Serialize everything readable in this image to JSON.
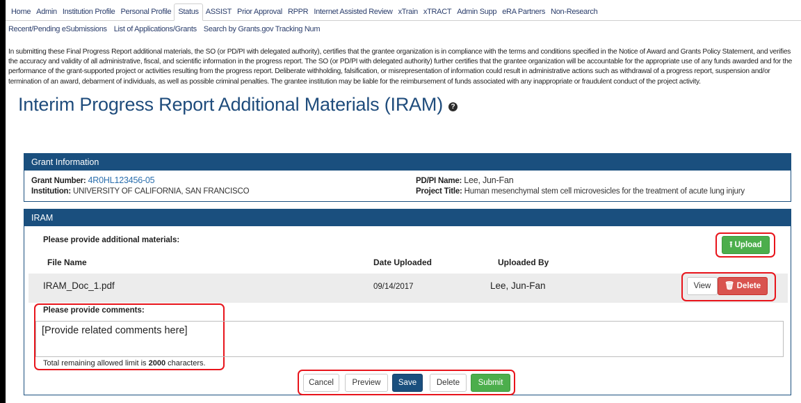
{
  "topnav": [
    "Home",
    "Admin",
    "Institution Profile",
    "Personal Profile",
    "Status",
    "ASSIST",
    "Prior Approval",
    "RPPR",
    "Internet Assisted Review",
    "xTrain",
    "xTRACT",
    "Admin Supp",
    "eRA Partners",
    "Non-Research"
  ],
  "topnav_active": "Status",
  "subnav": [
    "Recent/Pending eSubmissions",
    "List of Applications/Grants",
    "Search by Grants.gov Tracking Num"
  ],
  "certification_text": "In submitting these Final Progress Report additional materials, the SO (or PD/PI with delegated authority), certifies that the grantee organization is in compliance with the terms and conditions specified in the Notice of Award and Grants Policy Statement, and verifies the accuracy and validity of all administrative, fiscal, and scientific information in the progress report. The SO (or PD/PI with delegated authority) further certifies that the grantee organization will be accountable for the appropriate use of any funds awarded and for the performance of the grant-supported project or activities resulting from the progress report. Deliberate withholding, falsification, or misrepresentation of information could result in administrative actions such as withdrawal of a progress report, suspension and/or termination of an award, debarment of individuals, as well as possible criminal penalties. The grantee institution may be liable for the reimbursement of funds associated with any inappropriate or fraudulent conduct of the project activity.",
  "page_title": "Interim Progress Report Additional Materials (IRAM)",
  "grant_info": {
    "heading": "Grant Information",
    "grant_number_label": "Grant Number:",
    "grant_number": "4R0HL123456-05",
    "institution_label": "Institution:",
    "institution": "UNIVERSITY OF CALIFORNIA, SAN FRANCISCO",
    "pdpi_label": "PD/PI Name:",
    "pdpi": "Lee, Jun-Fan",
    "project_title_label": "Project Title:",
    "project_title": "Human mesenchymal stem cell microvesicles for the treatment of acute lung injury"
  },
  "iram": {
    "heading": "IRAM",
    "provide_materials": "Please provide additional materials:",
    "upload_label": "Upload",
    "columns": [
      "File Name",
      "Date Uploaded",
      "Uploaded By"
    ],
    "file": {
      "name": "IRAM_Doc_1.pdf",
      "date": "09/14/2017",
      "by": "Lee, Jun-Fan"
    },
    "view_label": "View",
    "delete_label": "Delete",
    "comments_label": "Please provide comments:",
    "comments_value": "[Provide related comments here]",
    "limit_prefix": "Total remaining allowed limit is ",
    "limit_value": "2000",
    "limit_suffix": " characters."
  },
  "actions": [
    "Cancel",
    "Preview",
    "Save",
    "Delete",
    "Submit"
  ],
  "colors": {
    "header_blue": "#1a4f7e",
    "green": "#4cae4c",
    "red": "#d9534f",
    "highlight": "#e8141b"
  },
  "icons": {
    "upload": "upload-icon",
    "trash": "trash-icon",
    "help": "question-circle-icon"
  }
}
